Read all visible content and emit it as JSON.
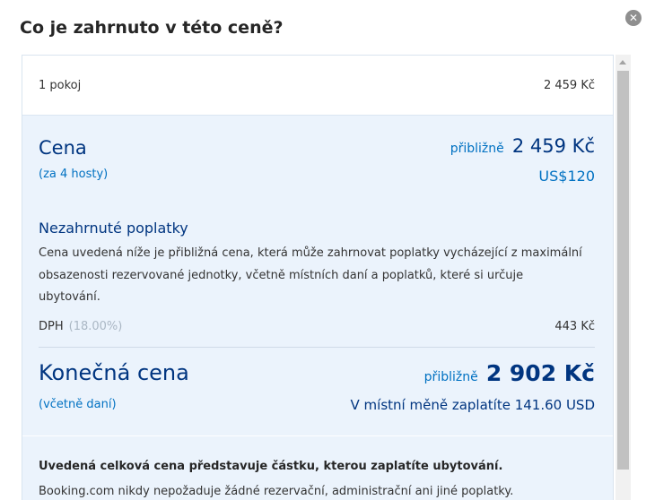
{
  "dialog": {
    "title": "Co je zahrnuto v této ceně?",
    "close_icon": "close-icon"
  },
  "room_row": {
    "label": "1 pokoj",
    "amount": "2 459 Kč"
  },
  "price": {
    "label": "Cena",
    "guests": "(za 4 hosty)",
    "approx_label": "přibližně",
    "amount": "2 459 Kč",
    "usd": "US$120"
  },
  "excluded": {
    "title": "Nezahrnuté poplatky",
    "text": "Cena uvedená níže je přibližná cena, která může zahrnovat poplatky vycházející z maximální obsazenosti rezervované jednotky, včetně místních daní a poplatků, které si určuje ubytování.",
    "vat_label": "DPH",
    "vat_percent": "(18.00%)",
    "vat_amount": "443 Kč"
  },
  "final": {
    "label": "Konečná cena",
    "sub": "(včetně daní)",
    "approx_label": "přibližně",
    "amount": "2 902 Kč",
    "local_currency": "V místní měně zaplatíte 141.60 USD"
  },
  "footer": {
    "bold_text": "Uvedená celková cena představuje částku, kterou zaplatíte ubytování.",
    "text": "Booking.com nikdy nepožaduje žádné rezervační, administrační ani jiné poplatky."
  },
  "colors": {
    "navy": "#003580",
    "link_blue": "#0071c2",
    "panel_bg": "#ebf3fc"
  }
}
